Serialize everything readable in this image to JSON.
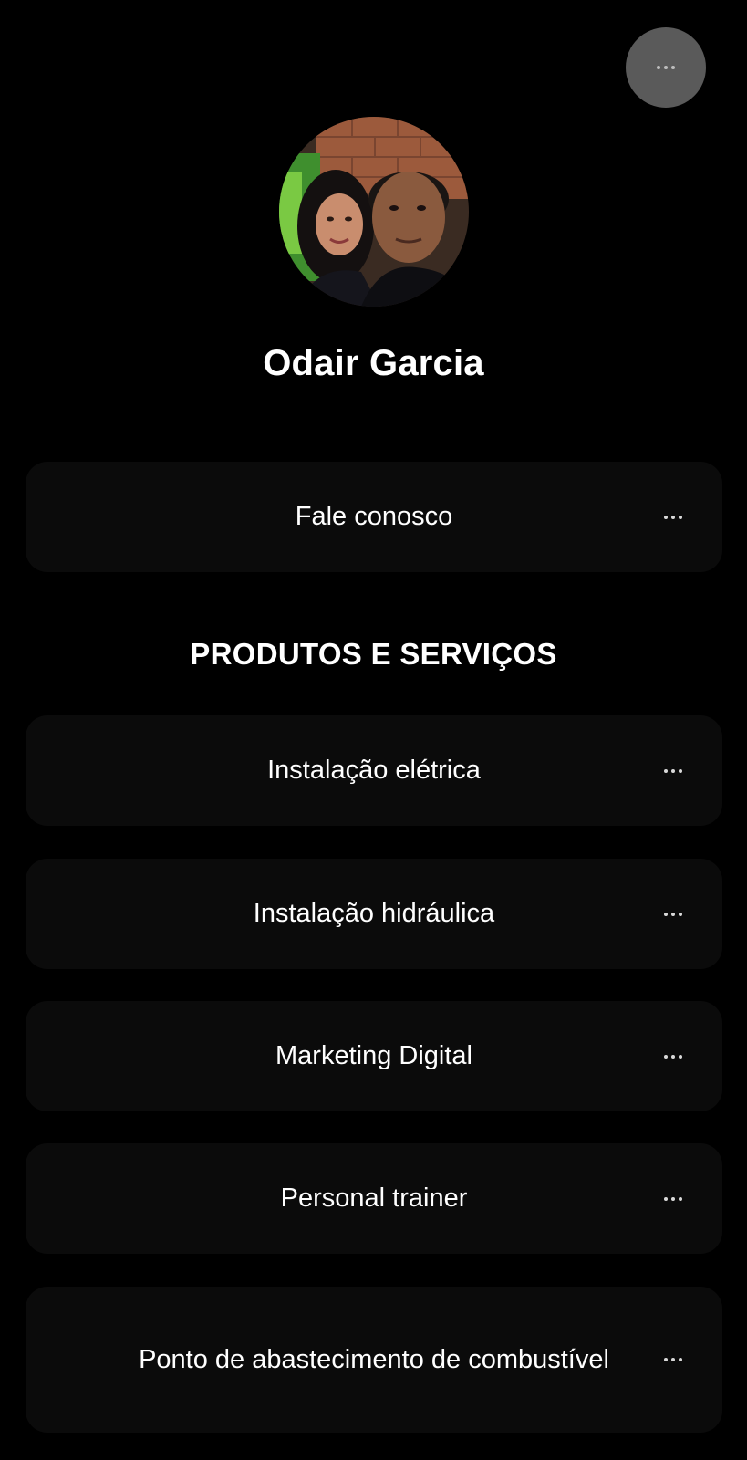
{
  "profile": {
    "name": "Odair Garcia",
    "avatar_icon": "profile-photo"
  },
  "top_menu": {
    "icon": "more-horizontal-icon"
  },
  "links": {
    "contact": {
      "label": "Fale conosco"
    }
  },
  "products_section": {
    "heading": "PRODUTOS E SERVIÇOS",
    "items": [
      {
        "label": "Instalação elétrica"
      },
      {
        "label": "Instalação hidráulica"
      },
      {
        "label": "Marketing Digital"
      },
      {
        "label": "Personal trainer"
      },
      {
        "label": "Ponto de abastecimento de combustível"
      }
    ]
  },
  "colors": {
    "background": "#000000",
    "card": "#0b0b0b",
    "menu_button": "#5a5a5a",
    "text": "#ffffff"
  }
}
